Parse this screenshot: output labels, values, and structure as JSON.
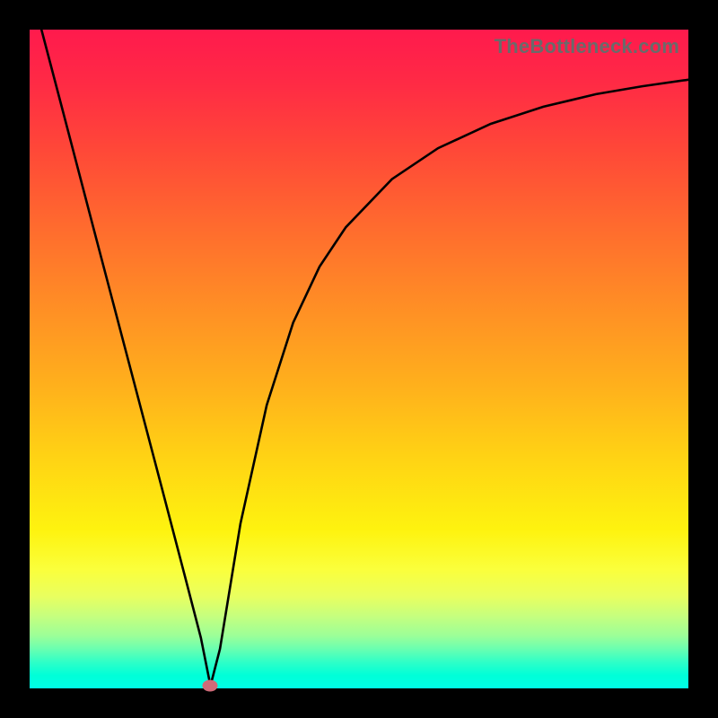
{
  "watermark": "TheBottleneck.com",
  "chart_data": {
    "type": "line",
    "title": "",
    "xlabel": "",
    "ylabel": "",
    "xlim": [
      0,
      1
    ],
    "ylim": [
      0,
      1
    ],
    "series": [
      {
        "name": "curve",
        "x": [
          0.018,
          0.05,
          0.1,
          0.15,
          0.2,
          0.235,
          0.26,
          0.2745,
          0.289,
          0.32,
          0.36,
          0.4,
          0.44,
          0.48,
          0.55,
          0.62,
          0.7,
          0.78,
          0.86,
          0.93,
          1.0
        ],
        "y": [
          1.0,
          0.878,
          0.687,
          0.497,
          0.307,
          0.173,
          0.077,
          0.004,
          0.06,
          0.25,
          0.43,
          0.555,
          0.64,
          0.7,
          0.773,
          0.82,
          0.857,
          0.883,
          0.902,
          0.914,
          0.924
        ]
      }
    ],
    "marker": {
      "x": 0.2745,
      "y": 0.004
    },
    "colors": {
      "curve_stroke": "#000000",
      "marker_fill": "#cf6a78",
      "frame_fill": "#000000"
    }
  }
}
